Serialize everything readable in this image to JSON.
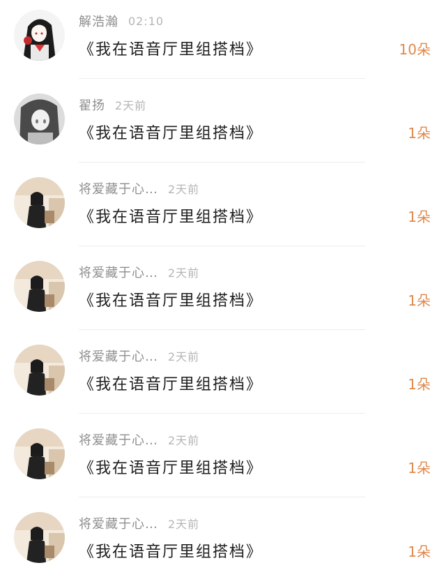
{
  "messages": [
    {
      "sender": "解浩瀚",
      "time": "02:10",
      "text": "《我在语音厅里组搭档》",
      "gift_count": "10朵",
      "avatar": "anime-girl-dark-hair-red-accents"
    },
    {
      "sender": "翟扬",
      "time": "2天前",
      "text": "《我在语音厅里组搭档》",
      "gift_count": "1朵",
      "avatar": "anime-girl-grayscale"
    },
    {
      "sender": "将爱藏于心…",
      "time": "2天前",
      "text": "《我在语音厅里组搭档》",
      "gift_count": "1朵",
      "avatar": "person-photo-sitting"
    },
    {
      "sender": "将爱藏于心…",
      "time": "2天前",
      "text": "《我在语音厅里组搭档》",
      "gift_count": "1朵",
      "avatar": "person-photo-sitting"
    },
    {
      "sender": "将爱藏于心…",
      "time": "2天前",
      "text": "《我在语音厅里组搭档》",
      "gift_count": "1朵",
      "avatar": "person-photo-sitting"
    },
    {
      "sender": "将爱藏于心…",
      "time": "2天前",
      "text": "《我在语音厅里组搭档》",
      "gift_count": "1朵",
      "avatar": "person-photo-sitting"
    },
    {
      "sender": "将爱藏于心…",
      "time": "2天前",
      "text": "《我在语音厅里组搭档》",
      "gift_count": "1朵",
      "avatar": "person-photo-sitting"
    }
  ]
}
